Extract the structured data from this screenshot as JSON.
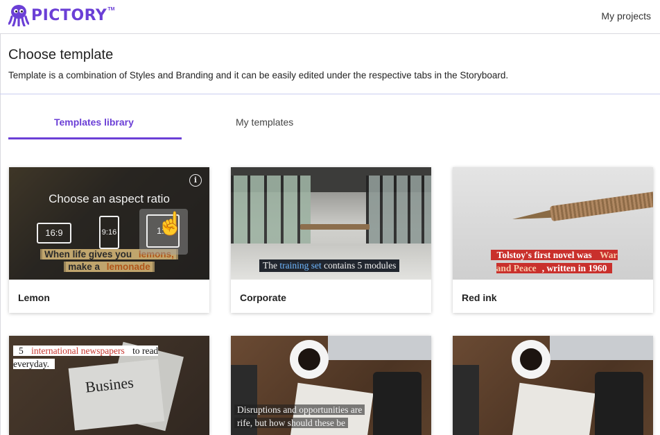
{
  "brand": {
    "name": "PICTORY",
    "tm": "TM"
  },
  "nav": {
    "my_projects": "My projects"
  },
  "header": {
    "title": "Choose template",
    "subtitle": "Template is a combination of Styles and Branding and it can be easily edited under the respective tabs in the Storyboard."
  },
  "tabs": [
    {
      "label": "Templates library",
      "active": true
    },
    {
      "label": "My templates",
      "active": false
    }
  ],
  "accent_color": "#6b3fd6",
  "templates": [
    {
      "label": "Lemon",
      "aspect_title": "Choose an aspect ratio",
      "ratios": [
        "16:9",
        "9:16",
        "1:1"
      ],
      "caption_line1_a": "When life gives you ",
      "caption_line1_hl": "lemons,",
      "caption_line2_a": "make a ",
      "caption_line2_hl": "lemonade"
    },
    {
      "label": "Corporate",
      "caption_a": "The ",
      "caption_hl": "training set",
      "caption_b": " contains 5 modules"
    },
    {
      "label": "Red ink",
      "caption_a": "Tolstoy's first novel was ",
      "caption_hl": "War and Peace",
      "caption_b": ", written in 1960"
    },
    {
      "caption_a": "5 ",
      "caption_hl": "international newspapers",
      "caption_b": " to read everyday.",
      "headline": "Busines"
    },
    {
      "caption_line1": "Disruptions and opportunities are",
      "caption_line2": "rife, but how should these be"
    },
    {}
  ]
}
